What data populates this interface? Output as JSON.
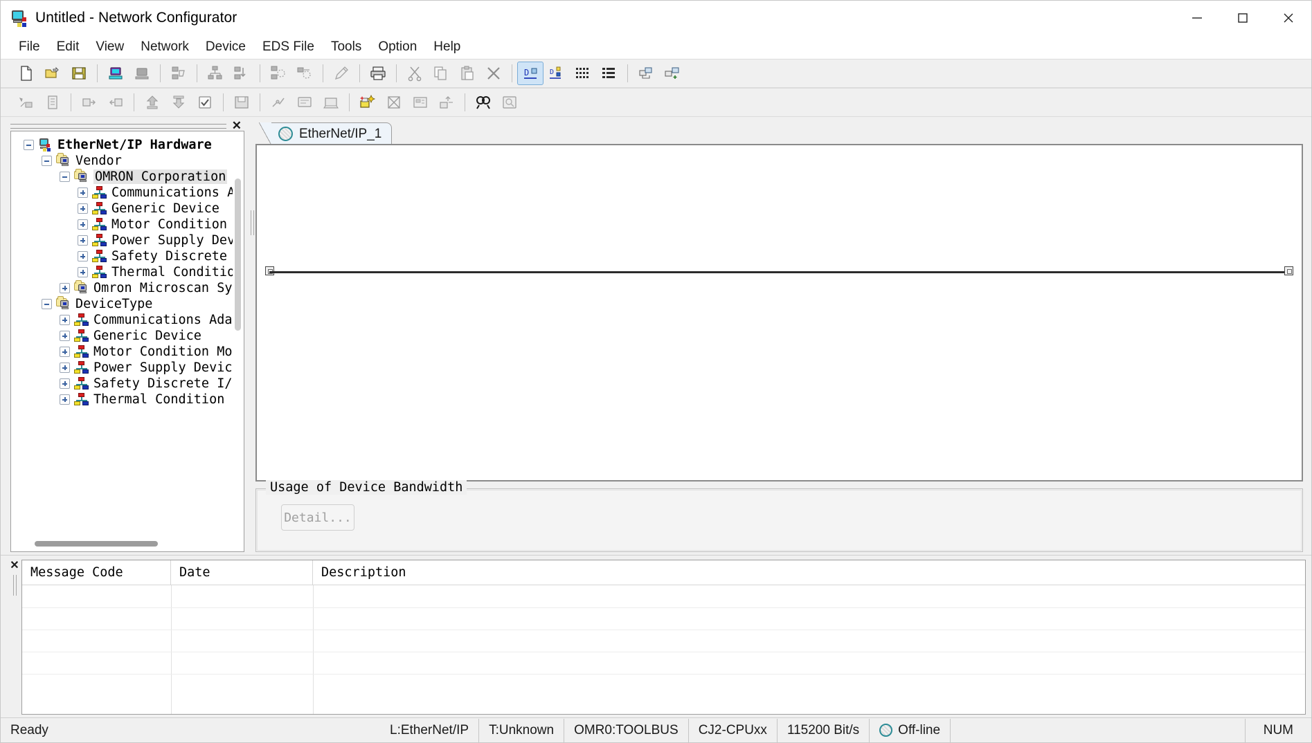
{
  "window": {
    "title": "Untitled - Network Configurator",
    "app_icon": "network-configurator-icon",
    "minimize": "minimize-icon",
    "maximize": "maximize-icon",
    "close": "close-icon"
  },
  "menubar": {
    "items": [
      {
        "label": "File"
      },
      {
        "label": "Edit"
      },
      {
        "label": "View"
      },
      {
        "label": "Network"
      },
      {
        "label": "Device"
      },
      {
        "label": "EDS File"
      },
      {
        "label": "Tools"
      },
      {
        "label": "Option"
      },
      {
        "label": "Help"
      }
    ]
  },
  "toolbar_top": {
    "buttons": [
      {
        "name": "new-icon",
        "enabled": true
      },
      {
        "name": "open-icon",
        "enabled": true
      },
      {
        "name": "save-icon",
        "enabled": true
      },
      {
        "sep": true
      },
      {
        "name": "connect-network-icon",
        "enabled": true
      },
      {
        "name": "disconnect-network-icon",
        "enabled": false
      },
      {
        "sep": true
      },
      {
        "name": "upload-from-network-icon",
        "enabled": false
      },
      {
        "sep": true
      },
      {
        "name": "download-to-network-icon",
        "enabled": false
      },
      {
        "name": "download-to-device-icon",
        "enabled": false
      },
      {
        "sep": true
      },
      {
        "name": "compare-network-icon",
        "enabled": false
      },
      {
        "name": "verify-network-icon",
        "enabled": false
      },
      {
        "sep": true
      },
      {
        "name": "edit-device-parameter-icon",
        "enabled": false
      },
      {
        "sep": true
      },
      {
        "name": "print-icon",
        "enabled": true
      },
      {
        "sep": true
      },
      {
        "name": "cut-icon",
        "enabled": false
      },
      {
        "name": "copy-icon",
        "enabled": false
      },
      {
        "name": "paste-icon",
        "enabled": false
      },
      {
        "name": "delete-icon",
        "enabled": false
      },
      {
        "sep": true
      },
      {
        "name": "large-icons-view-icon",
        "enabled": true,
        "active": true
      },
      {
        "name": "small-icons-view-icon",
        "enabled": true
      },
      {
        "name": "list-view-icon",
        "enabled": true
      },
      {
        "name": "detail-view-icon",
        "enabled": true
      },
      {
        "sep": true
      },
      {
        "name": "device-reference-icon",
        "enabled": true
      },
      {
        "name": "device-reference-add-icon",
        "enabled": true
      }
    ]
  },
  "toolbar_second": {
    "buttons": [
      {
        "name": "monitor-device-icon",
        "enabled": false
      },
      {
        "name": "device-parameter-icon",
        "enabled": false
      },
      {
        "sep": true
      },
      {
        "name": "register-to-network-icon",
        "enabled": false
      },
      {
        "name": "register-to-other-device-icon",
        "enabled": false
      },
      {
        "sep": true
      },
      {
        "name": "install-eds-file-icon",
        "enabled": false
      },
      {
        "name": "create-eds-file-icon",
        "enabled": false
      },
      {
        "name": "check-eds-icon",
        "enabled": false
      },
      {
        "sep": true
      },
      {
        "name": "save-eds-file-icon",
        "enabled": false
      },
      {
        "sep": true
      },
      {
        "name": "network-routing-icon",
        "enabled": false
      },
      {
        "name": "network-setup-icon",
        "enabled": false
      },
      {
        "name": "network-connection-icon",
        "enabled": false
      },
      {
        "sep": true
      },
      {
        "name": "add-device-icon",
        "enabled": true
      },
      {
        "name": "delete-device-icon",
        "enabled": false
      },
      {
        "name": "device-property-icon",
        "enabled": false
      },
      {
        "name": "change-node-address-icon",
        "enabled": false
      },
      {
        "sep": true
      },
      {
        "name": "find-icon",
        "enabled": true
      },
      {
        "name": "find-next-icon",
        "enabled": false
      }
    ]
  },
  "left_pane": {
    "close": "close-icon",
    "tree": [
      {
        "label": "EtherNet/IP Hardware",
        "depth": 0,
        "expander": "minus",
        "icon": "root-hardware-icon",
        "bold": true,
        "selected": false
      },
      {
        "label": "Vendor",
        "depth": 1,
        "expander": "minus",
        "icon": "folder-device-icon",
        "bold": false,
        "selected": false
      },
      {
        "label": "OMRON Corporation",
        "depth": 2,
        "expander": "minus",
        "icon": "folder-device-icon",
        "bold": false,
        "selected": true
      },
      {
        "label": "Communications Adap",
        "depth": 3,
        "expander": "plus",
        "icon": "device-node-icon",
        "bold": false,
        "selected": false
      },
      {
        "label": "Generic Device",
        "depth": 3,
        "expander": "plus",
        "icon": "device-node-icon",
        "bold": false,
        "selected": false
      },
      {
        "label": "Motor Condition Mon",
        "depth": 3,
        "expander": "plus",
        "icon": "device-node-icon",
        "bold": false,
        "selected": false
      },
      {
        "label": "Power Supply Device",
        "depth": 3,
        "expander": "plus",
        "icon": "device-node-icon",
        "bold": false,
        "selected": false
      },
      {
        "label": "Safety Discrete I/O",
        "depth": 3,
        "expander": "plus",
        "icon": "device-node-icon",
        "bold": false,
        "selected": false
      },
      {
        "label": "Thermal Condition M",
        "depth": 3,
        "expander": "plus",
        "icon": "device-node-icon",
        "bold": false,
        "selected": false
      },
      {
        "label": "Omron Microscan System",
        "depth": 2,
        "expander": "plus",
        "icon": "folder-device-icon",
        "bold": false,
        "selected": false
      },
      {
        "label": "DeviceType",
        "depth": 1,
        "expander": "minus",
        "icon": "folder-device-icon",
        "bold": false,
        "selected": false
      },
      {
        "label": "Communications Adapter",
        "depth": 2,
        "expander": "plus",
        "icon": "device-node-icon",
        "bold": false,
        "selected": false
      },
      {
        "label": "Generic Device",
        "depth": 2,
        "expander": "plus",
        "icon": "device-node-icon",
        "bold": false,
        "selected": false
      },
      {
        "label": "Motor Condition Monito",
        "depth": 2,
        "expander": "plus",
        "icon": "device-node-icon",
        "bold": false,
        "selected": false
      },
      {
        "label": "Power Supply Device",
        "depth": 2,
        "expander": "plus",
        "icon": "device-node-icon",
        "bold": false,
        "selected": false
      },
      {
        "label": "Safety Discrete I/O De",
        "depth": 2,
        "expander": "plus",
        "icon": "device-node-icon",
        "bold": false,
        "selected": false
      },
      {
        "label": "Thermal Condition Moni",
        "depth": 2,
        "expander": "plus",
        "icon": "device-node-icon",
        "bold": false,
        "selected": false
      }
    ]
  },
  "right_pane": {
    "tabs": [
      {
        "label": "EtherNet/IP_1",
        "icon": "network-tab-icon",
        "active": true
      }
    ],
    "bandwidth": {
      "legend": "Usage of Device Bandwidth",
      "detail_button": "Detail...",
      "detail_enabled": false
    }
  },
  "message_pane": {
    "close": "close-icon",
    "columns": [
      "Message Code",
      "Date",
      "Description"
    ],
    "rows": []
  },
  "statusbar": {
    "ready": "Ready",
    "cells": [
      {
        "name": "network-type",
        "text": "L:EtherNet/IP"
      },
      {
        "name": "target-type",
        "text": "T:Unknown"
      },
      {
        "name": "connection-name",
        "text": "OMR0:TOOLBUS"
      },
      {
        "name": "cpu-model",
        "text": "CJ2-CPUxx"
      },
      {
        "name": "baud-rate",
        "text": "115200 Bit/s"
      }
    ],
    "online_state": "Off-line",
    "online_icon": "offline-indicator-icon",
    "num_lock": "NUM"
  },
  "colors": {
    "accent_blue": "#1b33b5",
    "tab_active_bg": "#eef4fa",
    "selection_bg": "#e4e4e4",
    "toolbar_active_bg": "#cfe4f7"
  }
}
